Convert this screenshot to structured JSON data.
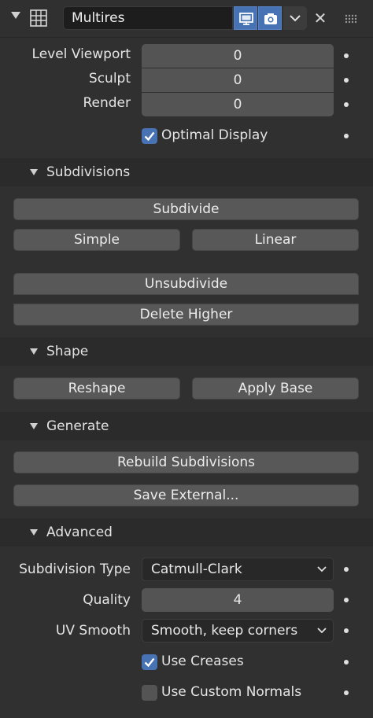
{
  "header": {
    "modifier_name": "Multires",
    "toggle_viewport_icon": "monitor-icon",
    "toggle_render_icon": "camera-icon",
    "close_glyph": "✕"
  },
  "levels": {
    "viewport_label": "Level Viewport",
    "viewport_value": "0",
    "sculpt_label": "Sculpt",
    "sculpt_value": "0",
    "render_label": "Render",
    "render_value": "0",
    "optimal_display_label": "Optimal Display",
    "optimal_display_checked": true
  },
  "subdivisions": {
    "title": "Subdivisions",
    "subdivide_label": "Subdivide",
    "simple_label": "Simple",
    "linear_label": "Linear",
    "unsubdivide_label": "Unsubdivide",
    "delete_higher_label": "Delete Higher"
  },
  "shape": {
    "title": "Shape",
    "reshape_label": "Reshape",
    "apply_base_label": "Apply Base"
  },
  "generate": {
    "title": "Generate",
    "rebuild_label": "Rebuild Subdivisions",
    "save_external_label": "Save External..."
  },
  "advanced": {
    "title": "Advanced",
    "subdivision_type_label": "Subdivision Type",
    "subdivision_type_value": "Catmull-Clark",
    "quality_label": "Quality",
    "quality_value": "4",
    "uv_smooth_label": "UV Smooth",
    "uv_smooth_value": "Smooth, keep corners",
    "use_creases_label": "Use Creases",
    "use_creases_checked": true,
    "use_custom_normals_label": "Use Custom Normals",
    "use_custom_normals_checked": false
  },
  "colors": {
    "accent": "#4772b3",
    "panel_bg": "#303030",
    "button_bg": "#585858"
  }
}
